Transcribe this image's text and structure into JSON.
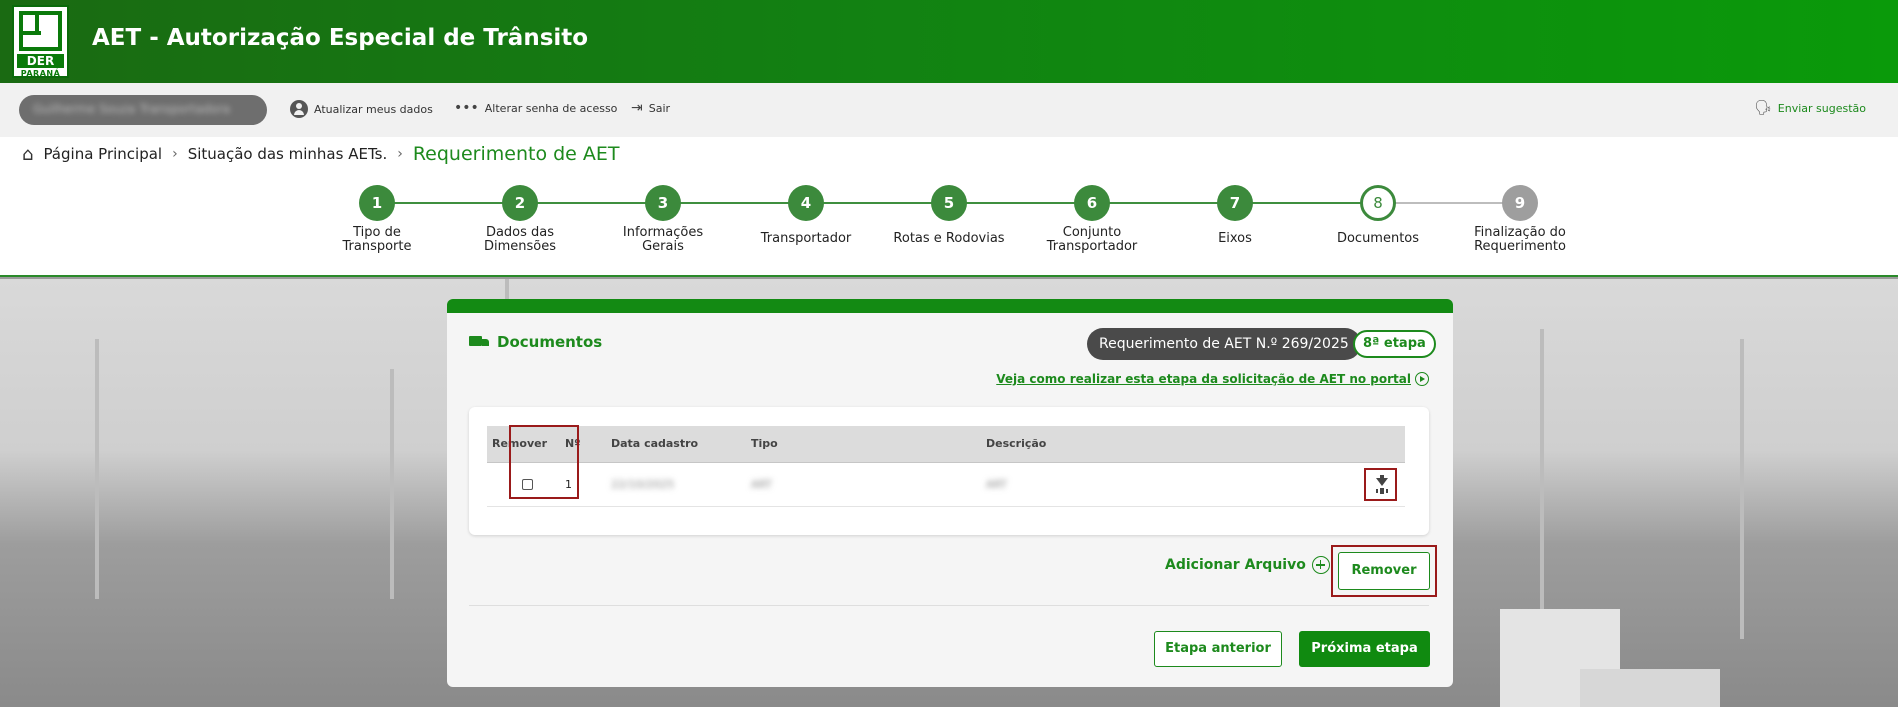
{
  "header": {
    "logo_text": "DER",
    "logo_subtext": "PARANÁ",
    "title": "AET - Autorização Especial de Trânsito"
  },
  "topbar": {
    "user_name": "Guilherme Souza Transportadora",
    "update_data": "Atualizar meus dados",
    "change_password": "Alterar senha de acesso",
    "logout": "Sair",
    "suggestion": "Enviar sugestão"
  },
  "breadcrumb": {
    "home": "Página Principal",
    "situation": "Situação das minhas AETs.",
    "current": "Requerimento de AET"
  },
  "steps": [
    {
      "number": "1",
      "label": "Tipo de Transporte",
      "state": "done"
    },
    {
      "number": "2",
      "label": "Dados das Dimensões",
      "state": "done"
    },
    {
      "number": "3",
      "label": "Informações Gerais",
      "state": "done"
    },
    {
      "number": "4",
      "label": "Transportador",
      "state": "done"
    },
    {
      "number": "5",
      "label": "Rotas e Rodovias",
      "state": "done"
    },
    {
      "number": "6",
      "label": "Conjunto Transportador",
      "state": "done"
    },
    {
      "number": "7",
      "label": "Eixos",
      "state": "done"
    },
    {
      "number": "8",
      "label": "Documentos",
      "state": "current"
    },
    {
      "number": "9",
      "label": "Finalização do Requerimento",
      "state": "pending"
    }
  ],
  "card": {
    "title": "Documentos",
    "request_badge": "Requerimento de AET N.º 269/2025",
    "stage_badge": "8ª etapa",
    "help_link": "Veja como realizar esta etapa da solicitação de AET no portal"
  },
  "table": {
    "headers": [
      "Remover",
      "Nº",
      "Data cadastro",
      "Tipo",
      "Descrição"
    ],
    "rows": [
      {
        "number": "1",
        "date": "22/10/2025",
        "type": "ART",
        "description": "ART"
      }
    ]
  },
  "actions": {
    "add_file": "Adicionar Arquivo",
    "remove": "Remover",
    "previous": "Etapa anterior",
    "next": "Próxima etapa"
  },
  "colors": {
    "brand_green": "#138a13",
    "highlight_red": "#9a1a1a"
  }
}
